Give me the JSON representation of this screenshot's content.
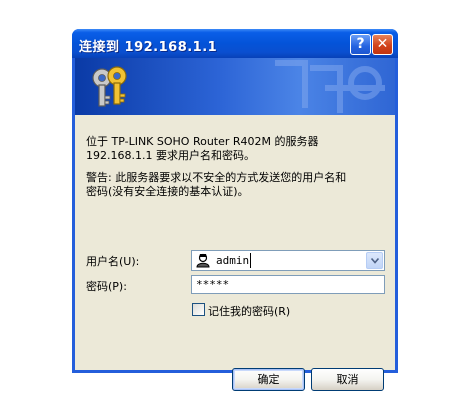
{
  "window": {
    "title": "连接到 192.168.1.1",
    "help_label": "?",
    "close_label": "✕",
    "accent_color": "#0a4fd0",
    "icons": [
      "keys-icon",
      "help-icon",
      "close-icon",
      "user-icon",
      "chevron-down-icon"
    ]
  },
  "message": {
    "line1": "位于 TP-LINK SOHO Router R402M 的服务器",
    "line2": "192.168.1.1 要求用户名和密码。",
    "warning_line1": "警告: 此服务器要求以不安全的方式发送您的用户名和",
    "warning_line2": "密码(没有安全连接的基本认证)。"
  },
  "form": {
    "username_label": "用户名(U):",
    "username_value": "admin",
    "password_label": "密码(P):",
    "password_value": "*****",
    "remember_label": "记住我的密码(R)",
    "remember_checked": false
  },
  "buttons": {
    "ok_label": "确定",
    "cancel_label": "取消"
  }
}
